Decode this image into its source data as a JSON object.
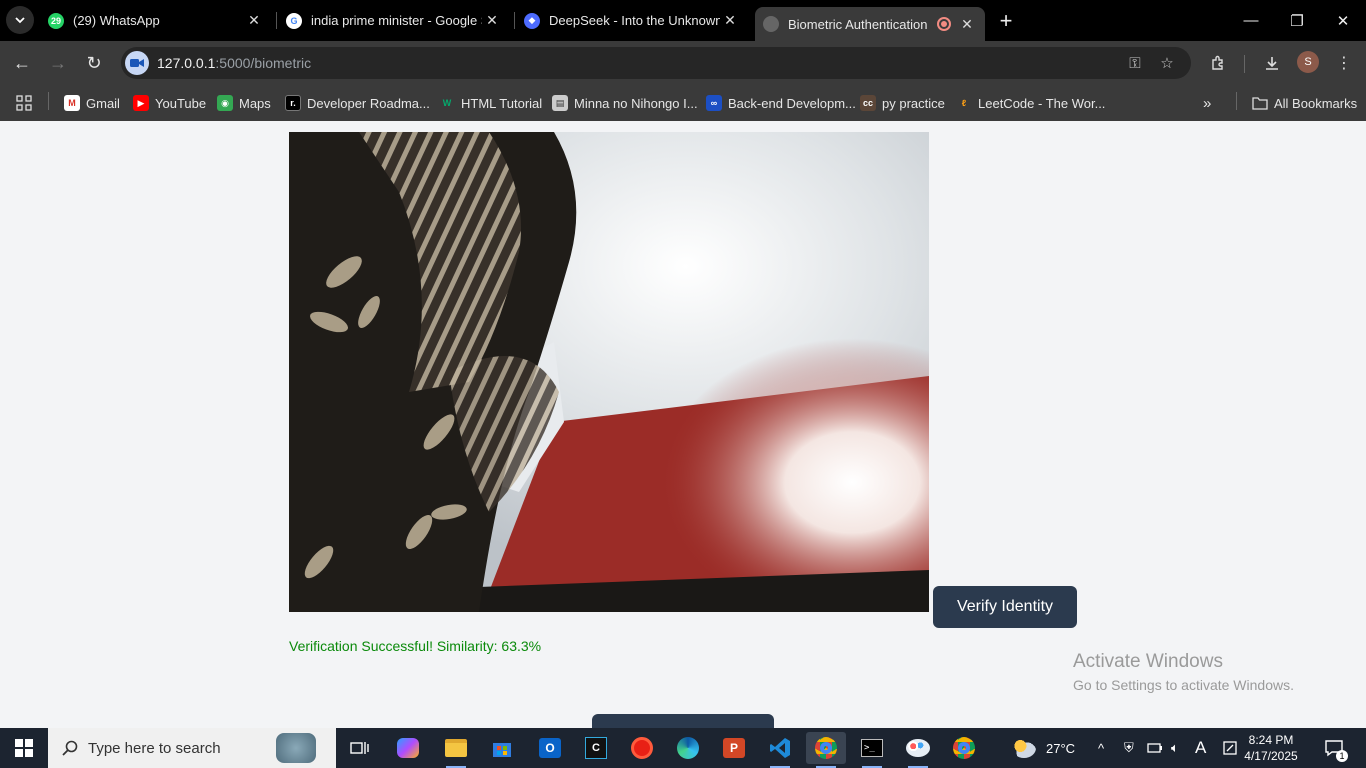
{
  "browser": {
    "tabs": [
      {
        "title": "(29) WhatsApp",
        "badge": "29",
        "active": false
      },
      {
        "title": "india prime minister - Google S",
        "active": false
      },
      {
        "title": "DeepSeek - Into the Unknown",
        "active": false
      },
      {
        "title": "Biometric Authentication",
        "active": true
      }
    ],
    "url_host": "127.0.0.1",
    "url_path": ":5000/biometric",
    "profile_initial": "S",
    "bookmarks": [
      {
        "label": "Gmail",
        "icon": "gmail-icon"
      },
      {
        "label": "YouTube",
        "icon": "youtube-icon"
      },
      {
        "label": "Maps",
        "icon": "maps-icon"
      },
      {
        "label": "Developer Roadma...",
        "icon": "roadmap-icon"
      },
      {
        "label": "HTML Tutorial",
        "icon": "w3schools-icon"
      },
      {
        "label": "Minna no Nihongo I...",
        "icon": "book-icon"
      },
      {
        "label": "Back-end Developm...",
        "icon": "meta-icon"
      },
      {
        "label": "py practice",
        "icon": "codechef-icon"
      },
      {
        "label": "LeetCode - The Wor...",
        "icon": "leetcode-icon"
      }
    ],
    "all_bookmarks": "All Bookmarks"
  },
  "page": {
    "verify_button": "Verify Identity",
    "result_text": "Verification Successful! Similarity: 63.3%",
    "result_color": "#0b8a0b"
  },
  "watermark": {
    "line1": "Activate Windows",
    "line2": "Go to Settings to activate Windows."
  },
  "taskbar": {
    "search_placeholder": "Type here to search",
    "weather": "27°C",
    "time": "8:24 PM",
    "date": "4/17/2025",
    "notifications": "1"
  }
}
